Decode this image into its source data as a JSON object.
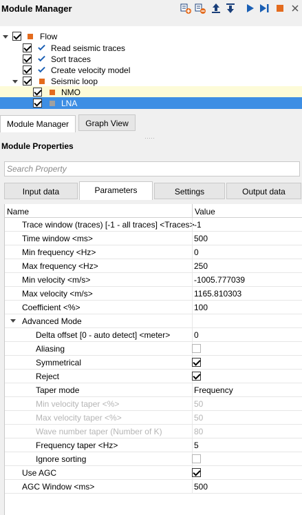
{
  "header": {
    "title": "Module Manager"
  },
  "toolbar": [
    "add-module-icon",
    "remove-module-icon",
    "move-up-icon",
    "move-down-icon",
    "run-icon",
    "run-step-icon",
    "stop-icon"
  ],
  "tree": {
    "items": [
      {
        "label": "Flow",
        "checked": true,
        "icon": "orange-square"
      },
      {
        "label": "Read seismic traces",
        "checked": true,
        "icon": "check"
      },
      {
        "label": "Sort traces",
        "checked": true,
        "icon": "check"
      },
      {
        "label": "Create velocity model",
        "checked": true,
        "icon": "check"
      },
      {
        "label": "Seismic loop",
        "checked": true,
        "icon": "orange-square"
      },
      {
        "label": "NMO",
        "checked": true,
        "icon": "orange-square"
      },
      {
        "label": "LNA",
        "checked": true,
        "icon": "grey-square",
        "selected": true
      }
    ]
  },
  "view_tabs": {
    "module_manager": "Module Manager",
    "graph_view": "Graph View"
  },
  "module_properties": {
    "title": "Module Properties"
  },
  "search": {
    "placeholder": "Search Property"
  },
  "prop_tabs": {
    "input": "Input data",
    "parameters": "Parameters",
    "settings": "Settings",
    "output": "Output data"
  },
  "columns": {
    "name": "Name",
    "value": "Value"
  },
  "rows": [
    {
      "name": "Trace window (traces) [-1 - all traces] <Traces>",
      "value": "-1"
    },
    {
      "name": "Time window <ms>",
      "value": "500"
    },
    {
      "name": "Min frequency <Hz>",
      "value": "0"
    },
    {
      "name": "Max frequency <Hz>",
      "value": "250"
    },
    {
      "name": "Min velocity <m/s>",
      "value": "-1005.777039"
    },
    {
      "name": "Max velocity <m/s>",
      "value": "1165.810303"
    },
    {
      "name": "Coefficient <%>",
      "value": "100"
    },
    {
      "name": "Advanced Mode",
      "value": ""
    },
    {
      "name": "Delta offset [0 - auto detect] <meter>",
      "value": "0"
    },
    {
      "name": "Aliasing",
      "value": ""
    },
    {
      "name": "Symmetrical",
      "value": ""
    },
    {
      "name": "Reject",
      "value": ""
    },
    {
      "name": "Taper mode",
      "value": "Frequency"
    },
    {
      "name": "Min velocity taper <%>",
      "value": "50"
    },
    {
      "name": "Max velocity taper <%>",
      "value": "50"
    },
    {
      "name": "Wave number taper (Number of K)",
      "value": "80"
    },
    {
      "name": "Frequency taper <Hz>",
      "value": "5"
    },
    {
      "name": "Ignore sorting",
      "value": ""
    },
    {
      "name": "Use AGC",
      "value": ""
    },
    {
      "name": "AGC Window <ms>",
      "value": "500"
    }
  ]
}
